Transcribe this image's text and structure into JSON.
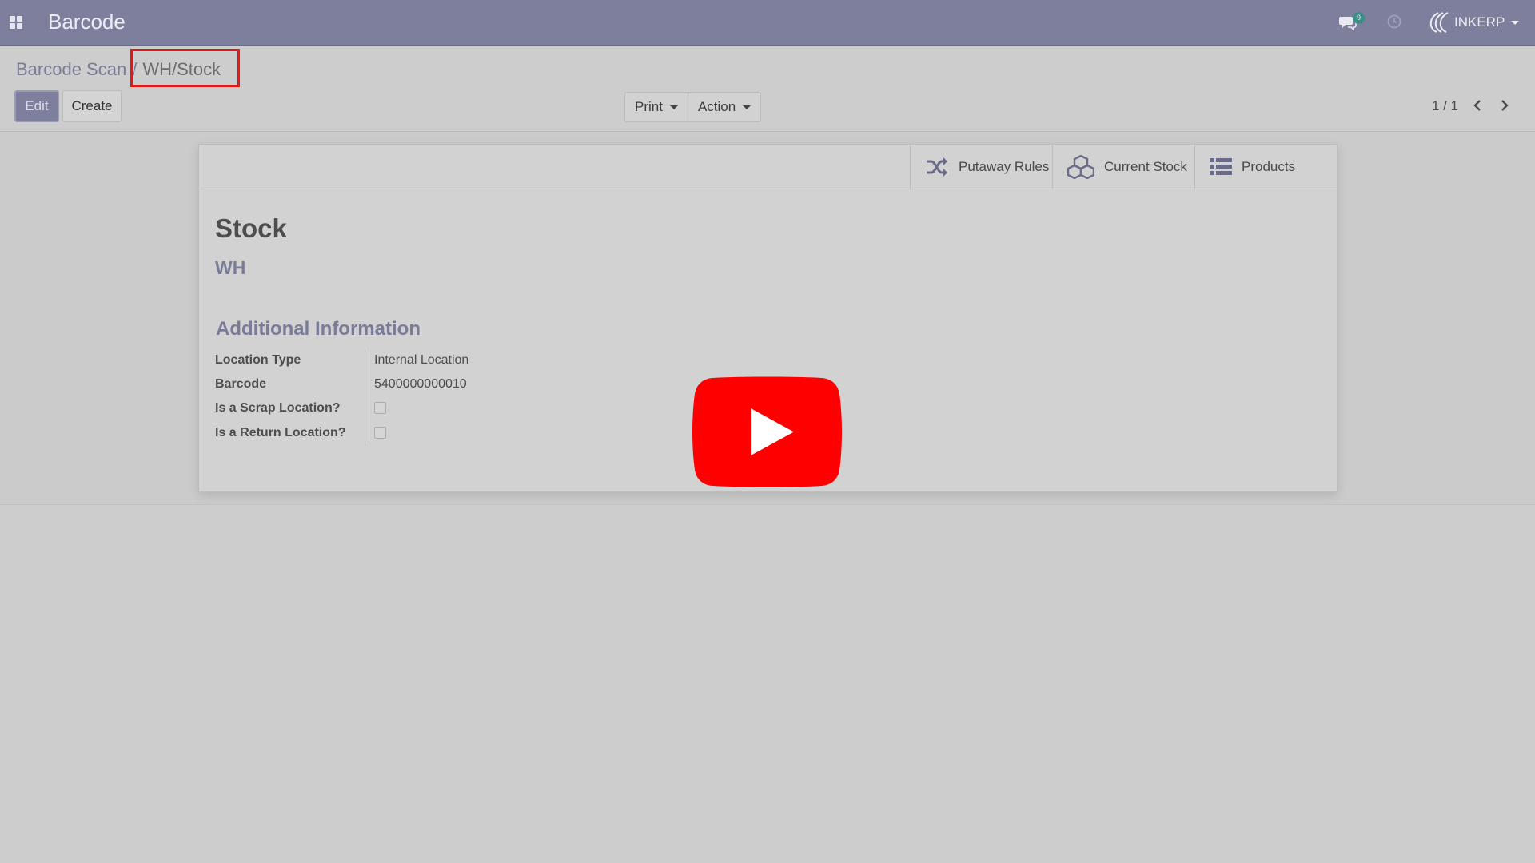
{
  "navbar": {
    "app_title": "Barcode",
    "chat_count": "9",
    "company_name": "INKERP",
    "bg_color": "#7e7f9d"
  },
  "breadcrumb": {
    "parent": "Barcode Scan",
    "separator": "/",
    "current": "WH/Stock"
  },
  "toolbar": {
    "edit_label": "Edit",
    "create_label": "Create",
    "print_label": "Print",
    "action_label": "Action"
  },
  "pager": {
    "value": "1 / 1"
  },
  "stat_buttons": [
    {
      "label": "Putaway Rules",
      "icon": "shuffle-icon"
    },
    {
      "label": "Current Stock",
      "icon": "cubes-icon"
    },
    {
      "label": "Products",
      "icon": "list-icon"
    }
  ],
  "form": {
    "name": "Stock",
    "parent_location": "WH",
    "section_title": "Additional Information",
    "fields": [
      {
        "label": "Location Type",
        "value": "Internal Location"
      },
      {
        "label": "Barcode",
        "value": "5400000000010"
      },
      {
        "label": "Is a Scrap Location?",
        "checked": false
      },
      {
        "label": "Is a Return Location?",
        "checked": false
      }
    ]
  },
  "overlay": {
    "icon": "youtube-play-icon",
    "color": "#ff0000",
    "highlight_color": "#e01a1a"
  }
}
